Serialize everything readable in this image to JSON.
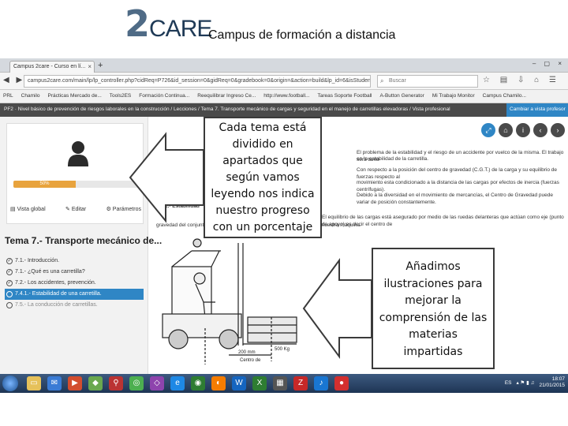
{
  "header": {
    "logo_number": "2",
    "logo_word": "CARE",
    "title": "Campus de formación a distancia"
  },
  "browser": {
    "tab_title": "Campus 2care - Curso en lí...",
    "url": "campus2care.com/main/lp/lp_controller.php?cidReq=P726&id_session=0&gidReq=0&gradebook=0&origin=&action=build&lp_id=6&isStudentView=true",
    "search_placeholder": "Buscar",
    "bookmarks": [
      "PRL",
      "Chamilo",
      "Prácticas Mercado de...",
      "Tools2ES",
      "Formación Continua...",
      "Reequilibrar Ingreso Ce...",
      "http://www.football...",
      "Tareas Soporte Football",
      "A-Button Generator",
      "Mi Trabajo Monitor",
      "Campus Chamilo..."
    ]
  },
  "course": {
    "breadcrumb": "PF2 · Nivel básico de prevención de riesgos laborales en la construcción  /  Lecciones  /  Tema 7. Transporte mecánico de cargas y seguridad en el manejo de carretillas elevadoras  /  Vista profesional",
    "view_button": "Cambiar a vista profesor",
    "progress_label": "50%",
    "progress_value": 0.5,
    "card_buttons": [
      "Vista global",
      "Editar",
      "Parámetros"
    ],
    "topic_title": "Tema 7.- Transporte mecánico de...",
    "topics": [
      {
        "label": "7.1.- Introducción.",
        "state": "done"
      },
      {
        "label": "7.1.- ¿Qué es una carretilla?",
        "state": "done"
      },
      {
        "label": "7.2.- Los accidentes, prevención.",
        "state": "done"
      },
      {
        "label": "7.4.1.- Estabilidad de una carretilla.",
        "state": "active"
      },
      {
        "label": "7.5.- La conducción de carretillas.",
        "state": "pending"
      }
    ],
    "section_heading": "Estabilidad de una carretilla",
    "paragraphs": [
      "El problema de la estabilidad y el riesgo de un accidente por vuelco de la misma. El trabajo será tanto",
      "en la estabilidad de la carretilla.",
      "Con respecto a la posición del centro de gravedad (C.G.T.) de la carga y su equilibrio de fuerzas respecto al",
      "movimiento esta condicionado a la distancia de las cargas por efectos de inercia (fuerzas centrífugas).",
      "Debido a la diversidad en el movimiento de mercancías, el Centro de Gravedad puede variar de posición constantemente.",
      "7.4.1.- Estabilidad",
      "El equilibrio de las cargas está asegurado por medio de las ruedas delanteras que actúan como eje (punto de apoyo) es decir el centro de",
      "gravedad del conjunto debe estar dentro de la proyección de los ejes de nuestra máquina."
    ],
    "figure_labels": {
      "weight": "500 Kg",
      "distance": "200 mm",
      "center": "Centro de"
    }
  },
  "taskbar": {
    "lang": "ES",
    "time": "18:07",
    "date": "21/01/2015"
  },
  "callouts": {
    "top": "Cada tema está dividido en apartados que según vamos leyendo nos indica nuestro progreso con un porcentaje",
    "right": "Añadimos ilustraciones para mejorar la comprensión de las materias impartidas"
  },
  "colors": {
    "accent_blue": "#2f86c5",
    "progress_orange": "#e8a33d",
    "breadcrumb_dark": "#4a4a4a",
    "logo_blue": "#4f6b86"
  }
}
